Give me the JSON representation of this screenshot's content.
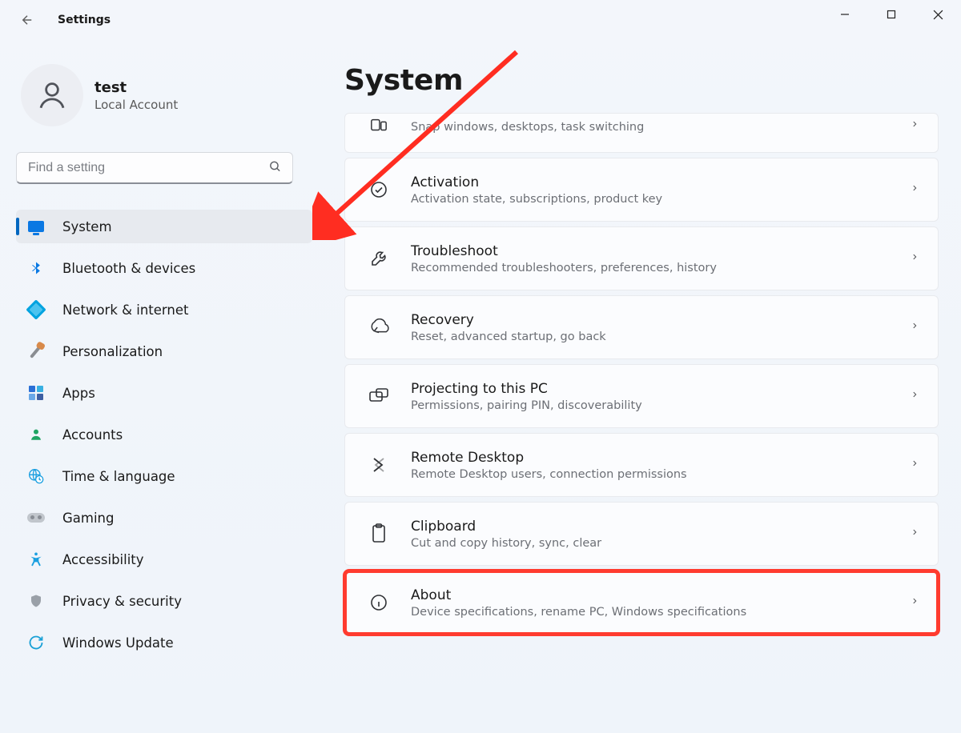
{
  "app_title": "Settings",
  "account": {
    "name": "test",
    "subtitle": "Local Account"
  },
  "search": {
    "placeholder": "Find a setting"
  },
  "nav": {
    "items": [
      {
        "label": "System",
        "icon": "monitor",
        "active": true
      },
      {
        "label": "Bluetooth & devices",
        "icon": "bluetooth",
        "active": false
      },
      {
        "label": "Network & internet",
        "icon": "wifi",
        "active": false
      },
      {
        "label": "Personalization",
        "icon": "brush",
        "active": false
      },
      {
        "label": "Apps",
        "icon": "apps",
        "active": false
      },
      {
        "label": "Accounts",
        "icon": "user",
        "active": false
      },
      {
        "label": "Time & language",
        "icon": "globe-clock",
        "active": false
      },
      {
        "label": "Gaming",
        "icon": "gamepad",
        "active": false
      },
      {
        "label": "Accessibility",
        "icon": "accessibility",
        "active": false
      },
      {
        "label": "Privacy & security",
        "icon": "shield",
        "active": false
      },
      {
        "label": "Windows Update",
        "icon": "update",
        "active": false
      }
    ]
  },
  "page": {
    "title": "System",
    "cards": [
      {
        "title": "",
        "subtitle": "Snap windows, desktops, task switching",
        "icon": "multitask",
        "truncated": true
      },
      {
        "title": "Activation",
        "subtitle": "Activation state, subscriptions, product key",
        "icon": "check"
      },
      {
        "title": "Troubleshoot",
        "subtitle": "Recommended troubleshooters, preferences, history",
        "icon": "wrench"
      },
      {
        "title": "Recovery",
        "subtitle": "Reset, advanced startup, go back",
        "icon": "recovery"
      },
      {
        "title": "Projecting to this PC",
        "subtitle": "Permissions, pairing PIN, discoverability",
        "icon": "project"
      },
      {
        "title": "Remote Desktop",
        "subtitle": "Remote Desktop users, connection permissions",
        "icon": "remote"
      },
      {
        "title": "Clipboard",
        "subtitle": "Cut and copy history, sync, clear",
        "icon": "clipboard"
      },
      {
        "title": "About",
        "subtitle": "Device specifications, rename PC, Windows specifications",
        "icon": "info",
        "highlight": true
      }
    ]
  }
}
